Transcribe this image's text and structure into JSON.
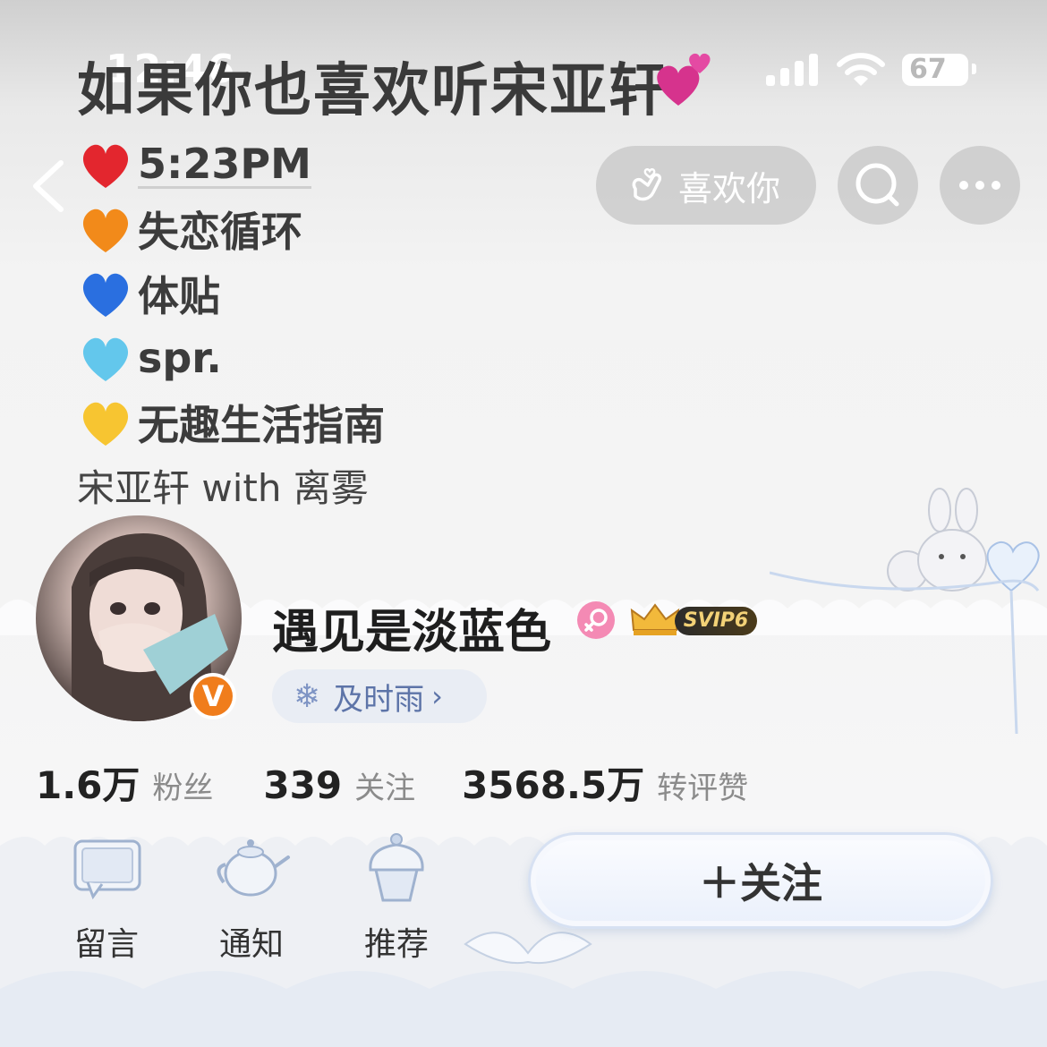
{
  "status_bar": {
    "time": "12:46",
    "battery": "67"
  },
  "banner": {
    "title": "如果你也喜欢听宋亚轩",
    "songs": [
      {
        "heart": "red-heart",
        "title": "5:23PM",
        "color": "#e3262e"
      },
      {
        "heart": "orange-heart",
        "title": "失恋循环",
        "color": "#f28a1a"
      },
      {
        "heart": "blue-heart",
        "title": "体贴",
        "color": "#2a6fe0"
      },
      {
        "heart": "light-blue-heart",
        "title": "spr.",
        "color": "#63c7ec"
      },
      {
        "heart": "yellow-heart",
        "title": "无趣生活指南",
        "color": "#f7c531"
      }
    ],
    "credit": "宋亚轩 with 离雾"
  },
  "nav": {
    "like_label": "喜欢你"
  },
  "profile": {
    "username": "遇见是淡蓝色",
    "vip_badge": "SVIP6",
    "verified_mark": "V",
    "song_tag": "及时雨",
    "chevron": "›"
  },
  "stats": [
    {
      "value": "1.6万",
      "label": "粉丝"
    },
    {
      "value": "339",
      "label": "关注"
    },
    {
      "value": "3568.5万",
      "label": "转评赞"
    }
  ],
  "actions": [
    {
      "label": "留言",
      "icon": "message-board-icon"
    },
    {
      "label": "通知",
      "icon": "teapot-icon"
    },
    {
      "label": "推荐",
      "icon": "cupcake-icon"
    }
  ],
  "follow_button": {
    "label": "＋关注"
  },
  "colors": {
    "accent_blue": "#5d74a8",
    "verified_orange": "#f07d1c",
    "female_pink": "#f48ab4",
    "svip_gold": "#f3d277"
  }
}
